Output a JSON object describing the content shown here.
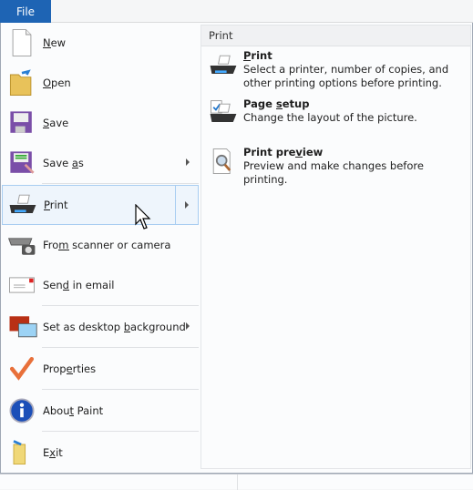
{
  "file_tab": "File",
  "left_menu": [
    {
      "label": "New",
      "accel": 0,
      "icon": "new-document-icon"
    },
    {
      "label": "Open",
      "accel": 0,
      "icon": "open-folder-icon"
    },
    {
      "label": "Save",
      "accel": 0,
      "icon": "save-floppy-icon"
    },
    {
      "label": "Save as",
      "accel": 5,
      "icon": "save-as-icon",
      "submenu": true
    },
    {
      "label": "Print",
      "accel": 0,
      "icon": "printer-icon",
      "submenu": true,
      "highlighted": true
    },
    {
      "label": "From scanner or camera",
      "accel": 3,
      "icon": "scanner-camera-icon"
    },
    {
      "label": "Send in email",
      "accel": 3,
      "icon": "email-icon"
    },
    {
      "label": "Set as desktop background",
      "accel": 15,
      "icon": "desktop-background-icon",
      "submenu": true
    },
    {
      "label": "Properties",
      "accel": 4,
      "icon": "checkmark-icon"
    },
    {
      "label": "About Paint",
      "accel": 4,
      "icon": "info-icon"
    },
    {
      "label": "Exit",
      "accel": 1,
      "icon": "exit-icon"
    }
  ],
  "submenu": {
    "header": "Print",
    "items": [
      {
        "title": "Print",
        "accel": 0,
        "desc": "Select a printer, number of copies, and other printing options before printing.",
        "icon": "printer-icon"
      },
      {
        "title": "Page setup",
        "accel": 5,
        "desc": "Change the layout of the picture.",
        "icon": "page-setup-icon"
      },
      {
        "title": "Print preview",
        "accel": 9,
        "desc": "Preview and make changes before printing.",
        "icon": "print-preview-icon"
      }
    ]
  },
  "colors": {
    "file_tab": "#1e64b4",
    "highlight": "#eef5fc",
    "highlight_border": "#a8cdf1"
  }
}
